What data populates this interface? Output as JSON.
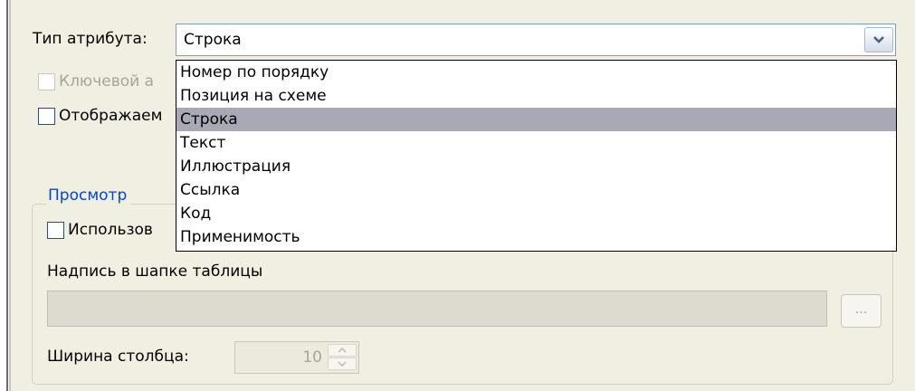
{
  "attribute_type": {
    "label": "Тип атрибута:",
    "value": "Строка",
    "options": [
      "Номер по порядку",
      "Позиция на схеме",
      "Строка",
      "Текст",
      "Иллюстрация",
      "Ссылка",
      "Код",
      "Применимость"
    ],
    "selected_option": "Строка"
  },
  "checkboxes": {
    "key_label": "Ключевой а",
    "displayed_label": "Отображаем"
  },
  "view_group": {
    "title": "Просмотр",
    "use_checkbox_label": "Использов",
    "header_caption_label": "Надпись в шапке таблицы",
    "header_caption_value": "",
    "browse_button_label": "...",
    "column_width_label": "Ширина столбца:",
    "column_width_value": "10"
  },
  "colors": {
    "panel_bg": "#f1efe2",
    "group_title": "#0046d5",
    "selected_item_bg": "#a9a9b6",
    "combo_border": "#7f9db9"
  }
}
